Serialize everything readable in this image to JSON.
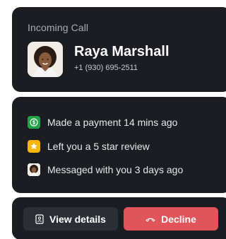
{
  "call": {
    "label": "Incoming Call",
    "caller_name": "Raya Marshall",
    "caller_phone": "+1 (930) 695-2511"
  },
  "activity": [
    {
      "icon": "dollar-icon",
      "color": "#22a34a",
      "text": "Made a payment 14 mins ago"
    },
    {
      "icon": "star-icon",
      "color": "#f5b60f",
      "text": "Left you a 5 star review"
    },
    {
      "icon": "avatar-icon",
      "color": "#f1ece6",
      "text": "Messaged with you 3 days ago"
    }
  ],
  "actions": {
    "details_label": "View details",
    "decline_label": "Decline"
  },
  "colors": {
    "card_bg": "#1b1d22",
    "decline": "#e0545a",
    "secondary_button": "#2b2e34"
  }
}
